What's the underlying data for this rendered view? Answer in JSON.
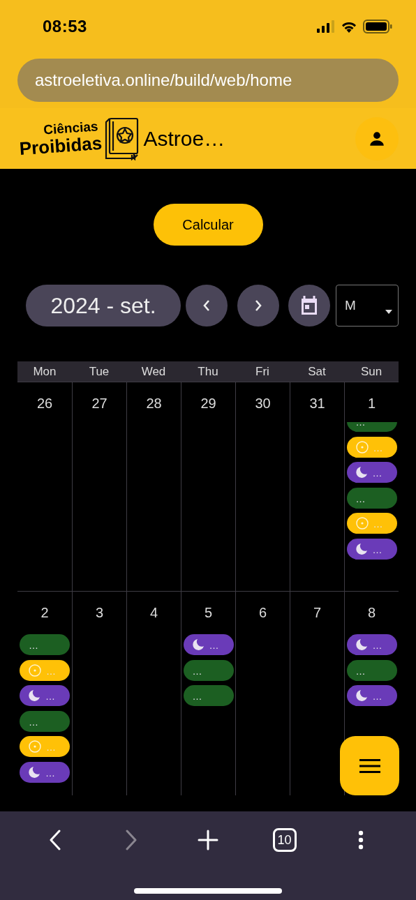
{
  "status_bar": {
    "time": "08:53"
  },
  "browser": {
    "url": "astroeletiva.online/build/web/home"
  },
  "app_bar": {
    "logo_top": "Ciências",
    "logo_bottom": "Proibidas",
    "title": "Astroe…"
  },
  "calculate_button": "Calcular",
  "calendar_toolbar": {
    "month": "2024 - set.",
    "view_select": "M"
  },
  "calendar": {
    "weekdays": [
      "Mon",
      "Tue",
      "Wed",
      "Thu",
      "Fri",
      "Sat",
      "Sun"
    ],
    "weeks": [
      {
        "days": [
          {
            "date": "26"
          },
          {
            "date": "27"
          },
          {
            "date": "28"
          },
          {
            "date": "29"
          },
          {
            "date": "30"
          },
          {
            "date": "31"
          },
          {
            "date": "1",
            "scrolled": true,
            "events": [
              {
                "kind": "plain",
                "text": "…"
              },
              {
                "kind": "sun",
                "text": "…"
              },
              {
                "kind": "moon",
                "text": "…"
              },
              {
                "kind": "plain",
                "text": "…"
              },
              {
                "kind": "sun",
                "text": "…"
              },
              {
                "kind": "moon",
                "text": "…"
              }
            ]
          }
        ]
      },
      {
        "days": [
          {
            "date": "2",
            "events": [
              {
                "kind": "plain",
                "text": "…"
              },
              {
                "kind": "sun",
                "text": "…"
              },
              {
                "kind": "moon",
                "text": "…"
              },
              {
                "kind": "plain",
                "text": "…"
              },
              {
                "kind": "sun",
                "text": "…"
              },
              {
                "kind": "moon",
                "text": "…"
              }
            ]
          },
          {
            "date": "3"
          },
          {
            "date": "4"
          },
          {
            "date": "5",
            "events": [
              {
                "kind": "moon",
                "text": "…"
              },
              {
                "kind": "plain",
                "text": "…"
              },
              {
                "kind": "plain",
                "text": "…"
              }
            ]
          },
          {
            "date": "6"
          },
          {
            "date": "7"
          },
          {
            "date": "8",
            "events": [
              {
                "kind": "moon",
                "text": "…"
              },
              {
                "kind": "plain",
                "text": "…"
              },
              {
                "kind": "moon",
                "text": "…"
              }
            ]
          }
        ]
      }
    ]
  },
  "bottom_nav": {
    "forward_disabled": true,
    "tab_count": "10"
  }
}
